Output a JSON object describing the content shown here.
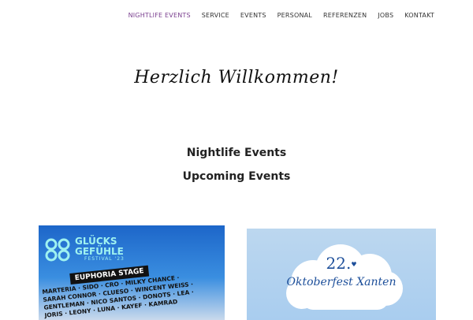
{
  "nav": {
    "items": [
      {
        "label": "NIGHTLIFE EVENTS",
        "active": true
      },
      {
        "label": "SERVICE"
      },
      {
        "label": "EVENTS"
      },
      {
        "label": "PERSONAL"
      },
      {
        "label": "REFERENZEN"
      },
      {
        "label": "JOBS"
      },
      {
        "label": "KONTAKT"
      }
    ],
    "active_color": "#7a3f8f"
  },
  "hero": {
    "title": "Herzlich Willkommen!"
  },
  "sections": {
    "nightlife": "Nightlife Events",
    "upcoming": "Upcoming Events"
  },
  "events": [
    {
      "title_line1": "GLÜCKS",
      "title_line2": "GEFÜHLE",
      "subtitle": "FESTIVAL '23",
      "stage": "EUPHORIA STAGE",
      "lineup": [
        "MARTERIA · SIDO · CRO · MILKY CHANCE ·",
        "SARAH CONNOR · CLUESO · WINCENT WEISS ·",
        "GENTLEMAN · NICO SANTOS · DONOTS · LEA ·",
        "JORIS · LEONY · LUNA · KAYEF · KAMRAD"
      ]
    },
    {
      "number": "22.",
      "heart": "♥",
      "name": "Oktoberfest Xanten"
    }
  ]
}
